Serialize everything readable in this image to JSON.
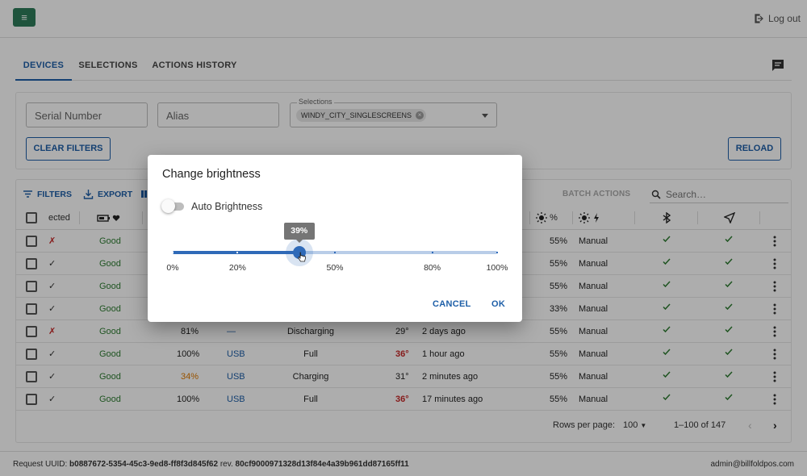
{
  "topbar": {
    "menu_icon": "≡",
    "logout_label": "Log out"
  },
  "tabs": [
    {
      "label": "DEVICES",
      "active": true
    },
    {
      "label": "SELECTIONS",
      "active": false
    },
    {
      "label": "ACTIONS HISTORY",
      "active": false
    }
  ],
  "filters": {
    "serial_placeholder": "Serial Number",
    "alias_placeholder": "Alias",
    "selections_label": "Selections",
    "selection_chip": "WINDY_CITY_SINGLESCREENS",
    "clear_filters": "CLEAR FILTERS",
    "reload": "RELOAD"
  },
  "toolbar": {
    "filters": "FILTERS",
    "export": "EXPORT",
    "batch_actions": "BATCH ACTIONS",
    "search_placeholder": "Search…"
  },
  "table": {
    "headers": {
      "selected": "ected",
      "brightness_percent": "%"
    },
    "rows": [
      {
        "mark": "✗",
        "status": "Good",
        "battery": "",
        "power": "",
        "state": "",
        "temp": "",
        "updated": "",
        "brightness": "55%",
        "mode": "Manual"
      },
      {
        "mark": "✓",
        "status": "Good",
        "battery": "",
        "power": "",
        "state": "",
        "temp": "",
        "updated": "",
        "brightness": "55%",
        "mode": "Manual"
      },
      {
        "mark": "✓",
        "status": "Good",
        "battery": "",
        "power": "",
        "state": "",
        "temp": "",
        "updated": "",
        "brightness": "55%",
        "mode": "Manual"
      },
      {
        "mark": "✓",
        "status": "Good",
        "battery": "",
        "power": "",
        "state": "",
        "temp": "",
        "updated": "",
        "brightness": "33%",
        "mode": "Manual"
      },
      {
        "mark": "✗",
        "status": "Good",
        "battery": "81%",
        "power": "—",
        "state": "Discharging",
        "temp": "29°",
        "updated": "2 days ago",
        "brightness": "55%",
        "mode": "Manual"
      },
      {
        "mark": "✓",
        "status": "Good",
        "battery": "100%",
        "power": "USB",
        "state": "Full",
        "temp": "36°",
        "updated": "1 hour ago",
        "brightness": "55%",
        "mode": "Manual"
      },
      {
        "mark": "✓",
        "status": "Good",
        "battery": "34%",
        "power": "USB",
        "state": "Charging",
        "temp": "31°",
        "updated": "2 minutes ago",
        "brightness": "55%",
        "mode": "Manual"
      },
      {
        "mark": "✓",
        "status": "Good",
        "battery": "100%",
        "power": "USB",
        "state": "Full",
        "temp": "36°",
        "updated": "17 minutes ago",
        "brightness": "55%",
        "mode": "Manual"
      }
    ],
    "footer": {
      "rows_per_page_label": "Rows per page:",
      "rows_per_page": "100",
      "range": "1–100 of 147"
    }
  },
  "status_bar": {
    "request_label": "Request UUID:",
    "request_uuid": "b0887672-5354-45c3-9ed8-ff8f3d845f62",
    "rev_label": "rev.",
    "rev": "80cf9000971328d13f84e4a39b961dd87165ff11",
    "user": "admin@billfoldpos.com"
  },
  "dialog": {
    "title": "Change brightness",
    "auto_brightness_label": "Auto Brightness",
    "auto_brightness_on": false,
    "slider_value": 39,
    "slider_value_label": "39%",
    "marks": [
      {
        "value": 0,
        "label": "0%"
      },
      {
        "value": 20,
        "label": "20%"
      },
      {
        "value": 50,
        "label": "50%"
      },
      {
        "value": 80,
        "label": "80%"
      },
      {
        "value": 100,
        "label": "100%"
      }
    ],
    "cancel": "CANCEL",
    "ok": "OK"
  },
  "colors": {
    "accent": "#1e5fa8",
    "menu_button": "#2e7d5b",
    "good": "#2e7d32",
    "warning": "#e07b00",
    "hot": "#c62828"
  }
}
